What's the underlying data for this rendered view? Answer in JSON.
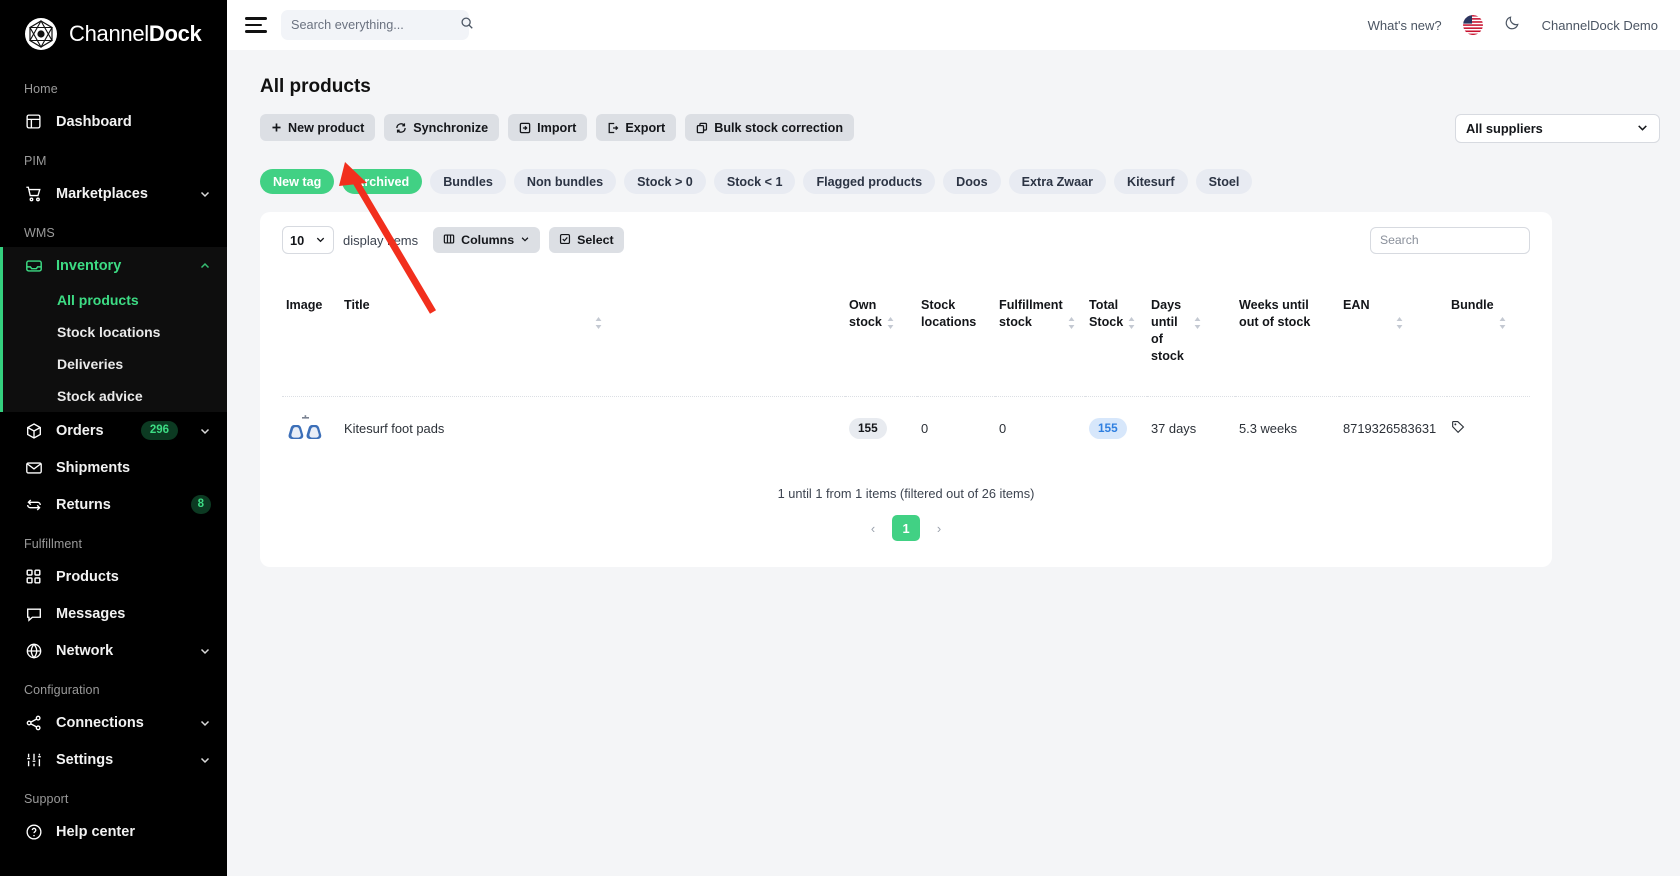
{
  "brand": {
    "name_light": "Channel",
    "name_bold": "Dock",
    "accent_green": "#3ddc84",
    "pill_green": "#41d184"
  },
  "sidebar": {
    "sections": [
      {
        "label": "Home",
        "items": [
          {
            "label": "Dashboard",
            "icon": "dashboard-icon",
            "active": false,
            "expandable": false
          }
        ]
      },
      {
        "label": "PIM",
        "items": [
          {
            "label": "Marketplaces",
            "icon": "cart-icon",
            "active": false,
            "expandable": true
          }
        ]
      },
      {
        "label": "WMS",
        "items": [
          {
            "label": "Inventory",
            "icon": "inbox-icon",
            "active": true,
            "expandable": true,
            "expanded": true,
            "children": [
              {
                "label": "All products",
                "active": true
              },
              {
                "label": "Stock locations",
                "active": false
              },
              {
                "label": "Deliveries",
                "active": false
              },
              {
                "label": "Stock advice",
                "active": false
              }
            ]
          },
          {
            "label": "Orders",
            "icon": "box-icon",
            "badge": "296",
            "expandable": true
          },
          {
            "label": "Shipments",
            "icon": "envelope-icon",
            "expandable": false
          },
          {
            "label": "Returns",
            "icon": "return-icon",
            "badge": "8",
            "expandable": false
          }
        ]
      },
      {
        "label": "Fulfillment",
        "items": [
          {
            "label": "Products",
            "icon": "grid-icon",
            "expandable": false
          },
          {
            "label": "Messages",
            "icon": "chat-icon",
            "expandable": false
          },
          {
            "label": "Network",
            "icon": "globe-icon",
            "expandable": true
          }
        ]
      },
      {
        "label": "Configuration",
        "items": [
          {
            "label": "Connections",
            "icon": "share-icon",
            "expandable": true
          },
          {
            "label": "Settings",
            "icon": "sliders-icon",
            "expandable": true
          }
        ]
      },
      {
        "label": "Support",
        "items": [
          {
            "label": "Help center",
            "icon": "question-circle-icon",
            "expandable": false
          }
        ]
      }
    ]
  },
  "topbar": {
    "menu_icon": "hamburger-icon",
    "search_placeholder": "Search everything...",
    "search_value": "",
    "search_icon": "search-icon",
    "whats_new": "What's new?",
    "language_icon": "us-flag-icon",
    "theme_icon": "moon-icon",
    "username": "ChannelDock Demo"
  },
  "page": {
    "title": "All products",
    "actions": [
      {
        "label": "New product",
        "icon": "plus-icon"
      },
      {
        "label": "Synchronize",
        "icon": "sync-icon"
      },
      {
        "label": "Import",
        "icon": "import-icon"
      },
      {
        "label": "Export",
        "icon": "export-icon"
      },
      {
        "label": "Bulk stock correction",
        "icon": "copy-icon"
      }
    ],
    "supplier_filter": {
      "value": "All suppliers",
      "icon": "chevron-down-icon"
    },
    "tags": [
      {
        "label": "New tag",
        "style": "green"
      },
      {
        "label": "Archived",
        "style": "green"
      },
      {
        "label": "Bundles",
        "style": "gray"
      },
      {
        "label": "Non bundles",
        "style": "gray"
      },
      {
        "label": "Stock > 0",
        "style": "gray"
      },
      {
        "label": "Stock < 1",
        "style": "gray"
      },
      {
        "label": "Flagged products",
        "style": "gray"
      },
      {
        "label": "Doos",
        "style": "gray"
      },
      {
        "label": "Extra Zwaar",
        "style": "gray"
      },
      {
        "label": "Kitesurf",
        "style": "gray"
      },
      {
        "label": "Stoel",
        "style": "gray"
      }
    ]
  },
  "table": {
    "page_length": "10",
    "page_length_label": "display items",
    "columns_button": "Columns",
    "select_button": "Select",
    "search_placeholder": "Search",
    "search_value": "",
    "headers": [
      {
        "label": "Image",
        "sortable": false
      },
      {
        "label": "Title",
        "sortable": true
      },
      {
        "label": "Own\nstock",
        "sortable": true
      },
      {
        "label": "Stock\nlocations",
        "sortable": true
      },
      {
        "label": "Fulfillment\nstock",
        "sortable": true
      },
      {
        "label": "Total\nStock",
        "sortable": true
      },
      {
        "label": "Days until\nof stock",
        "sortable": true
      },
      {
        "label": "Weeks until\nout of stock",
        "sortable": false
      },
      {
        "label": "EAN",
        "sortable": true
      },
      {
        "label": "Bundle",
        "sortable": true
      }
    ],
    "rows": [
      {
        "image": "kitesurf-foot-pads-thumbnail",
        "title": "Kitesurf foot pads",
        "own_stock": "155",
        "stock_locations": "0",
        "fulfillment_stock": "0",
        "total_stock": "155",
        "days_until_out_of_stock": "37 days",
        "weeks_until_out_of_stock": "5.3 weeks",
        "ean": "8719326583631",
        "bundle_icon": "tag-icon"
      }
    ],
    "pager_info": "1 until 1 from 1 items (filtered out of 26 items)",
    "pager": {
      "prev": "‹",
      "pages": [
        "1"
      ],
      "next": "›",
      "current": "1"
    }
  },
  "annotation": {
    "type": "red-arrow",
    "color": "#f22f1d"
  }
}
